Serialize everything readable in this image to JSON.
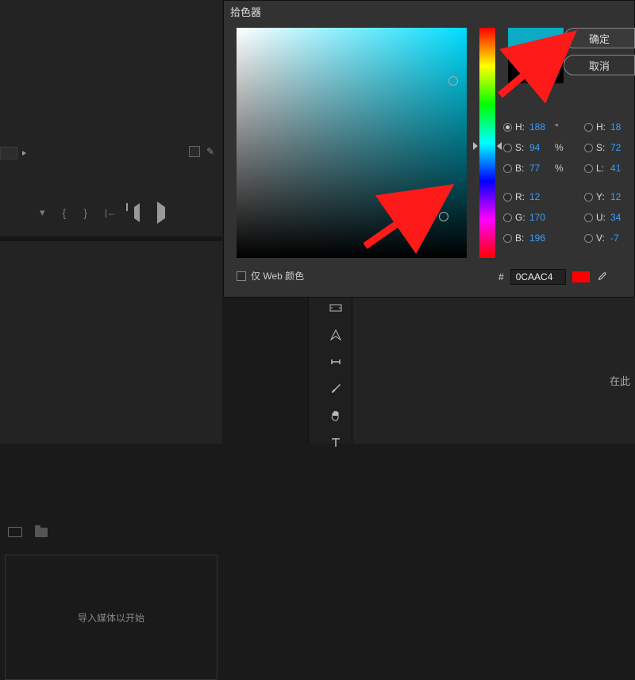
{
  "dialog": {
    "title": "拾色器",
    "ok": "确定",
    "cancel": "取消",
    "web_only": "仅 Web 颜色",
    "hash": "#",
    "hex": "0CAAC4",
    "preview_new": "#0CAAC4",
    "preview_old": "#000000",
    "hsb": {
      "h_label": "H:",
      "h_val": "188",
      "h_unit": "°",
      "s_label": "S:",
      "s_val": "94",
      "s_unit": "%",
      "b_label": "B:",
      "b_val": "77",
      "b_unit": "%"
    },
    "rgb": {
      "r_label": "R:",
      "r_val": "12",
      "g_label": "G:",
      "g_val": "170",
      "b_label": "B:",
      "b_val": "196"
    },
    "hsl": {
      "h_label": "H:",
      "h_val": "18",
      "s_label": "S:",
      "s_val": "72",
      "l_label": "L:",
      "l_val": "41"
    },
    "yuv": {
      "y_label": "Y:",
      "y_val": "12",
      "u_label": "U:",
      "u_val": "34",
      "v_label": "V:",
      "v_val": "-7"
    }
  },
  "left_panel": {
    "import_hint": "导入媒体以开始"
  },
  "right_hint": "在此"
}
